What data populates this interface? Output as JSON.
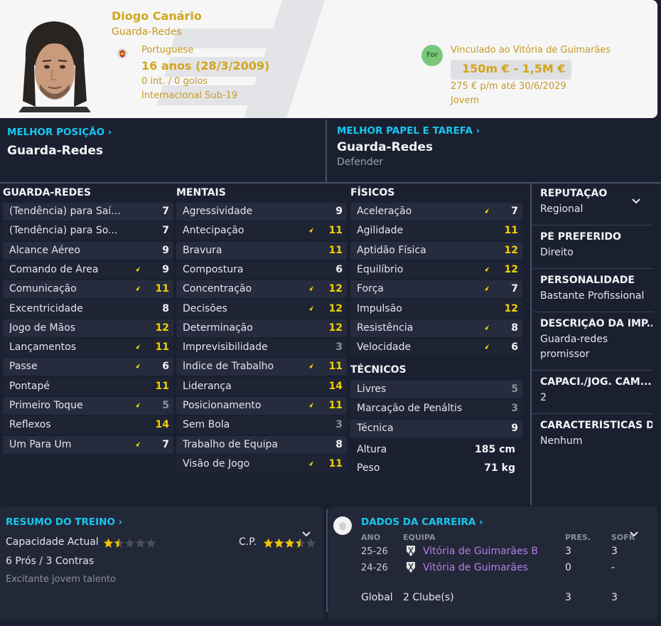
{
  "player": {
    "name": "Diogo Canário",
    "position": "Guarda-Redes",
    "nationality": "Portuguese",
    "age": "16 anos (28/3/2009)",
    "caps": "0 int. / 0 golos",
    "youth": "Internacional Sub-19"
  },
  "contract": {
    "badge": "For",
    "club_line": "Vinculado ao Vitória de Guimarães",
    "value": "150m € - 1,5M €",
    "wage": "275 € p/m até 30/6/2029",
    "status": "Jovem"
  },
  "best_position": {
    "title": "MELHOR POSIÇÃO",
    "value": "Guarda-Redes"
  },
  "best_role": {
    "title": "MELHOR PAPEL E TAREFA",
    "value": "Guarda-Redes",
    "duty": "Defender"
  },
  "colors": {
    "accent": "#16c7f0",
    "gold": "#d2a51d",
    "yellow": "#f0d000",
    "grey": "#8a8f9c",
    "bg": "#1b2030"
  },
  "goalkeeping": {
    "title": "GUARDA-REDES",
    "rows": [
      {
        "label": "(Tendência) para Saí...",
        "value": "7",
        "tone": "white",
        "arrow": false
      },
      {
        "label": "(Tendência) para So...",
        "value": "7",
        "tone": "white",
        "arrow": false
      },
      {
        "label": "Alcance Aéreo",
        "value": "9",
        "tone": "white",
        "arrow": false
      },
      {
        "label": "Comando de Área",
        "value": "9",
        "tone": "white",
        "arrow": true
      },
      {
        "label": "Comunicação",
        "value": "11",
        "tone": "yellow",
        "arrow": true
      },
      {
        "label": "Excentricidade",
        "value": "8",
        "tone": "white",
        "arrow": false
      },
      {
        "label": "Jogo de Mãos",
        "value": "12",
        "tone": "yellow",
        "arrow": false
      },
      {
        "label": "Lançamentos",
        "value": "11",
        "tone": "yellow",
        "arrow": true
      },
      {
        "label": "Passe",
        "value": "6",
        "tone": "white",
        "arrow": true
      },
      {
        "label": "Pontapé",
        "value": "11",
        "tone": "yellow",
        "arrow": false
      },
      {
        "label": "Primeiro Toque",
        "value": "5",
        "tone": "grey",
        "arrow": true
      },
      {
        "label": "Reflexos",
        "value": "14",
        "tone": "yellow",
        "arrow": false
      },
      {
        "label": "Um Para Um",
        "value": "7",
        "tone": "white",
        "arrow": true
      }
    ]
  },
  "mental": {
    "title": "MENTAIS",
    "rows": [
      {
        "label": "Agressividade",
        "value": "9",
        "tone": "white",
        "arrow": false
      },
      {
        "label": "Antecipação",
        "value": "11",
        "tone": "yellow",
        "arrow": true
      },
      {
        "label": "Bravura",
        "value": "11",
        "tone": "yellow",
        "arrow": false
      },
      {
        "label": "Compostura",
        "value": "6",
        "tone": "white",
        "arrow": false
      },
      {
        "label": "Concentração",
        "value": "12",
        "tone": "yellow",
        "arrow": true
      },
      {
        "label": "Decisões",
        "value": "12",
        "tone": "yellow",
        "arrow": true
      },
      {
        "label": "Determinação",
        "value": "12",
        "tone": "yellow",
        "arrow": false
      },
      {
        "label": "Imprevisibilidade",
        "value": "3",
        "tone": "grey",
        "arrow": false
      },
      {
        "label": "Índice de Trabalho",
        "value": "11",
        "tone": "yellow",
        "arrow": true
      },
      {
        "label": "Liderança",
        "value": "14",
        "tone": "yellow",
        "arrow": false
      },
      {
        "label": "Posicionamento",
        "value": "11",
        "tone": "yellow",
        "arrow": true
      },
      {
        "label": "Sem Bola",
        "value": "3",
        "tone": "grey",
        "arrow": false
      },
      {
        "label": "Trabalho de Equipa",
        "value": "8",
        "tone": "white",
        "arrow": false
      },
      {
        "label": "Visão de Jogo",
        "value": "11",
        "tone": "yellow",
        "arrow": true
      }
    ]
  },
  "physical": {
    "title": "FÍSICOS",
    "rows": [
      {
        "label": "Aceleração",
        "value": "7",
        "tone": "white",
        "arrow": true
      },
      {
        "label": "Agilidade",
        "value": "11",
        "tone": "yellow",
        "arrow": false
      },
      {
        "label": "Aptidão Física",
        "value": "12",
        "tone": "yellow",
        "arrow": false
      },
      {
        "label": "Equilíbrio",
        "value": "12",
        "tone": "yellow",
        "arrow": true
      },
      {
        "label": "Força",
        "value": "7",
        "tone": "white",
        "arrow": true
      },
      {
        "label": "Impulsão",
        "value": "12",
        "tone": "yellow",
        "arrow": false
      },
      {
        "label": "Resistência",
        "value": "8",
        "tone": "white",
        "arrow": true
      },
      {
        "label": "Velocidade",
        "value": "6",
        "tone": "white",
        "arrow": true
      }
    ]
  },
  "technical": {
    "title": "TÉCNICOS",
    "rows": [
      {
        "label": "Livres",
        "value": "5",
        "tone": "grey",
        "arrow": false
      },
      {
        "label": "Marcação de Penáltis",
        "value": "3",
        "tone": "grey",
        "arrow": false
      },
      {
        "label": "Técnica",
        "value": "9",
        "tone": "white",
        "arrow": false
      }
    ],
    "height_label": "Altura",
    "height": "185 cm",
    "weight_label": "Peso",
    "weight": "71 kg"
  },
  "info": [
    {
      "title": "REPUTAÇÃO",
      "value": "Regional"
    },
    {
      "title": "PÉ PREFERIDO",
      "value": "Direito"
    },
    {
      "title": "PERSONALIDADE",
      "value": "Bastante Profissional"
    },
    {
      "title": "DESCRIÇÃO DA IMP...",
      "value": "Guarda-redes promissor"
    },
    {
      "title": "CAPACI./JOG. CAM...",
      "value": "2"
    },
    {
      "title": "CARACTERÍSTICAS DE",
      "value": "Nenhum"
    }
  ],
  "training": {
    "title": "RESUMO DO TREINO",
    "ca_label": "Capacidade Actual",
    "ca_stars": 1.5,
    "cp_label": "C.P.",
    "cp_stars": 3.5,
    "pros_cons": "6 Prós / 3 Contras",
    "note": "Excitante jovem talento"
  },
  "career": {
    "title": "DADOS DA CARREIRA",
    "headers": {
      "year": "ANO",
      "team": "EQUIPA",
      "apps": "PRES.",
      "conc": "SOFR"
    },
    "rows": [
      {
        "year": "25-26",
        "team": "Vitória de Guimarães B",
        "apps": "3",
        "conc": "3"
      },
      {
        "year": "24-26",
        "team": "Vitória de Guimarães",
        "apps": "0",
        "conc": "-"
      }
    ],
    "total": {
      "label": "Global",
      "clubs": "2 Clube(s)",
      "apps": "3",
      "conc": "3"
    }
  }
}
